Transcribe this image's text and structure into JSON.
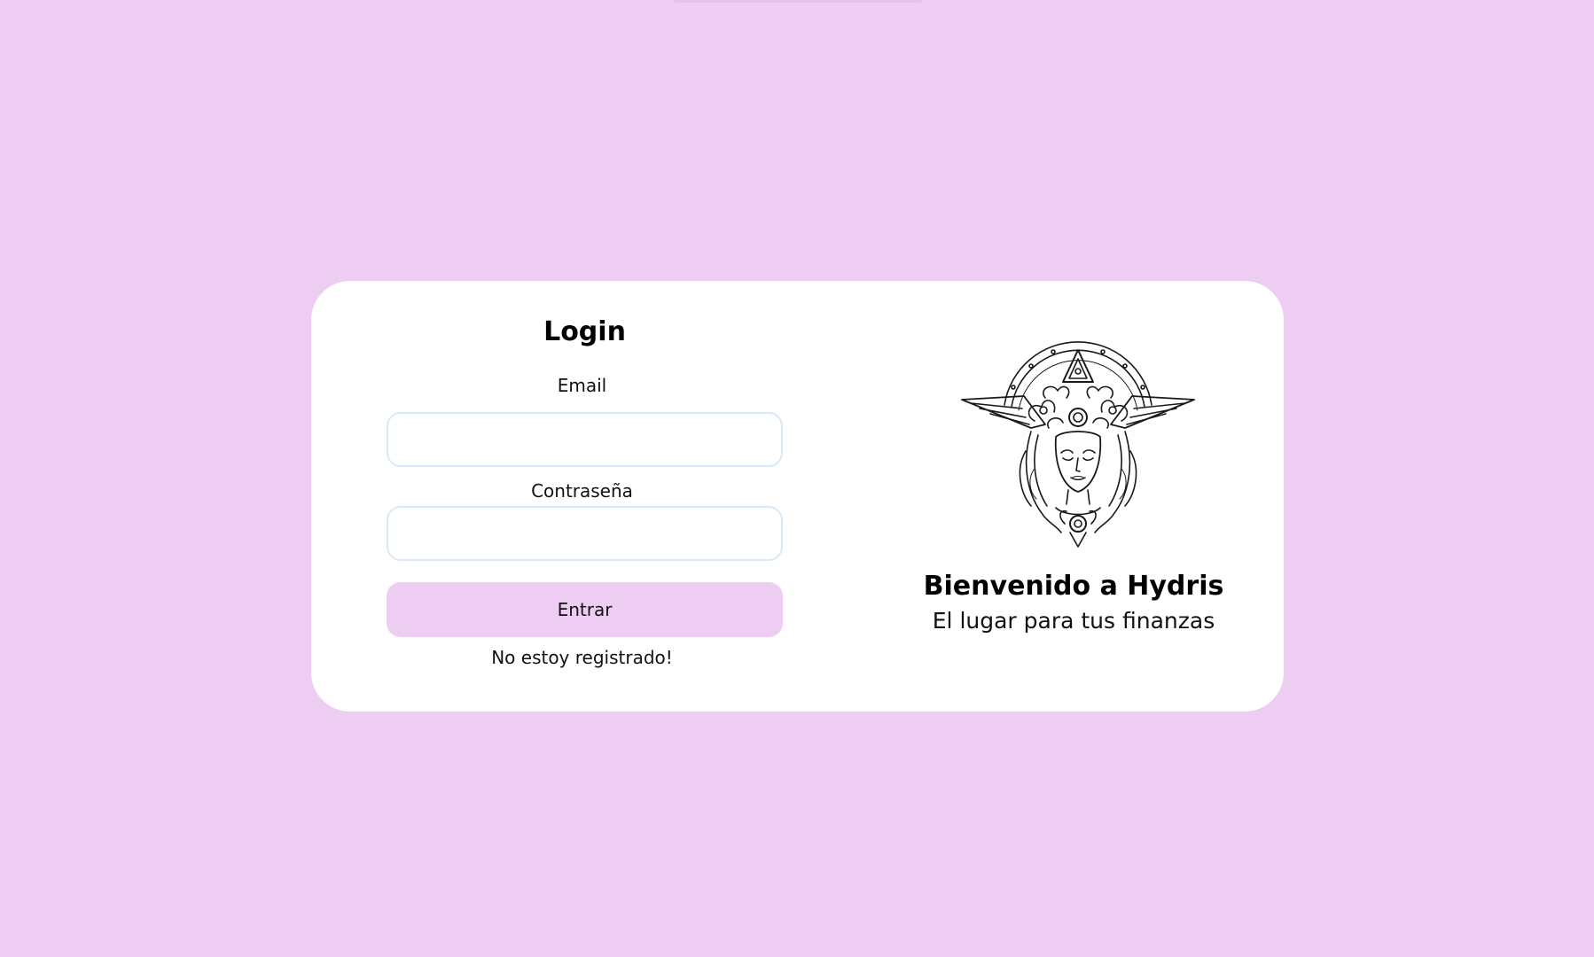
{
  "login": {
    "title": "Login",
    "email_label": "Email",
    "email_value": "",
    "password_label": "Contraseña",
    "password_value": "",
    "submit_label": "Entrar",
    "register_link": "No estoy registrado!"
  },
  "brand": {
    "logo_icon": "goddess-medusa-logo",
    "heading": "Bienvenido a Hydris",
    "tagline": "El lugar para tus finanzas"
  },
  "colors": {
    "background": "#eecdf3",
    "card": "#ffffff",
    "button": "#eecdf3",
    "input_border": "#dbe9f6"
  }
}
